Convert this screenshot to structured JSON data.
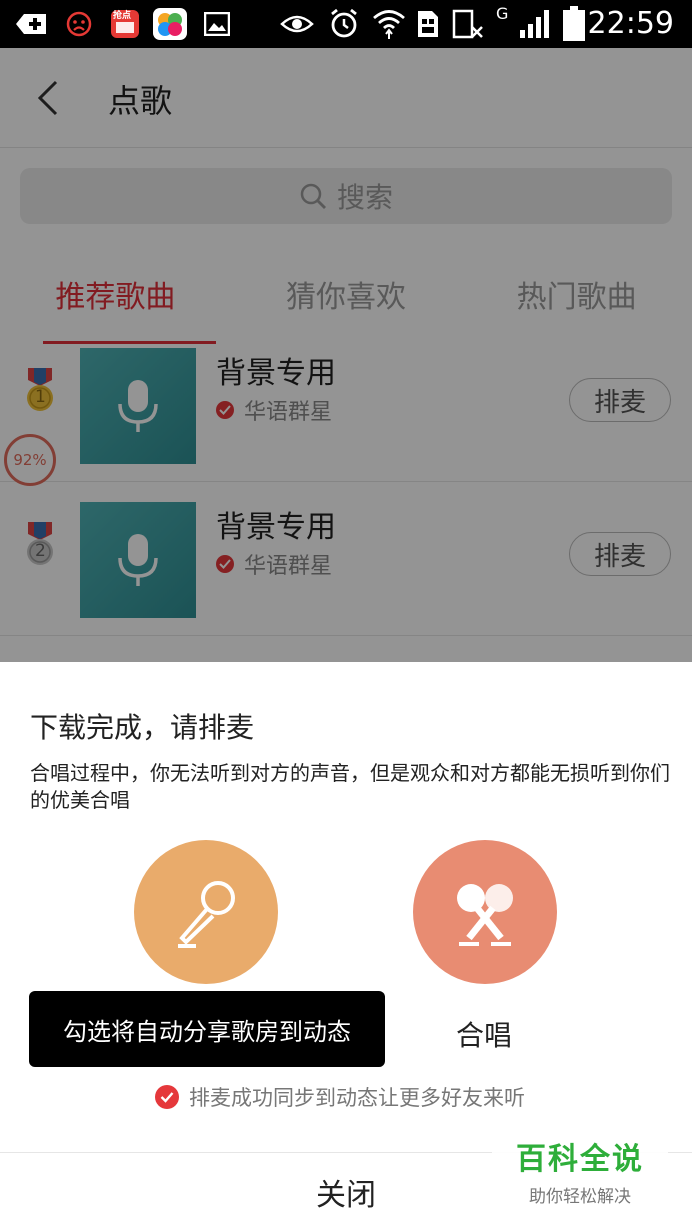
{
  "status_bar": {
    "time": "22:59",
    "network_label": "G",
    "notification_badge": "抢点",
    "icons": [
      "add-icon",
      "face-icon",
      "app-icon",
      "gallery-icon",
      "image-icon",
      "eye-icon",
      "alarm-icon",
      "wifi-icon",
      "sim-icon",
      "data-icon",
      "signal-icon",
      "battery-icon"
    ]
  },
  "nav": {
    "title": "点歌"
  },
  "search": {
    "placeholder": "搜索"
  },
  "tabs": [
    {
      "label": "推荐歌曲",
      "active": true
    },
    {
      "label": "猜你喜欢",
      "active": false
    },
    {
      "label": "热门歌曲",
      "active": false
    }
  ],
  "songs": [
    {
      "rank": "1",
      "title": "背景专用",
      "artist": "华语群星",
      "button": "排麦"
    },
    {
      "rank": "2",
      "title": "背景专用",
      "artist": "华语群星",
      "button": "排麦"
    }
  ],
  "progress_badge": "92%",
  "sheet": {
    "title": "下载完成，请排麦",
    "description": "合唱过程中，你无法听到对方的声音，但是观众和对方都能无损听到你们的优美合唱",
    "duet_label": "合唱",
    "tooltip": "勾选将自动分享歌房到动态",
    "sync_text": "排麦成功同步到动态让更多好友来听",
    "close_label": "关闭"
  },
  "watermark": {
    "main": "百科全说",
    "sub": "助你轻松解决"
  },
  "colors": {
    "accent": "#e0303a",
    "solo_circle": "#e9ab6b",
    "duet_circle": "#e88c72",
    "watermark_green": "#2eae3a"
  }
}
